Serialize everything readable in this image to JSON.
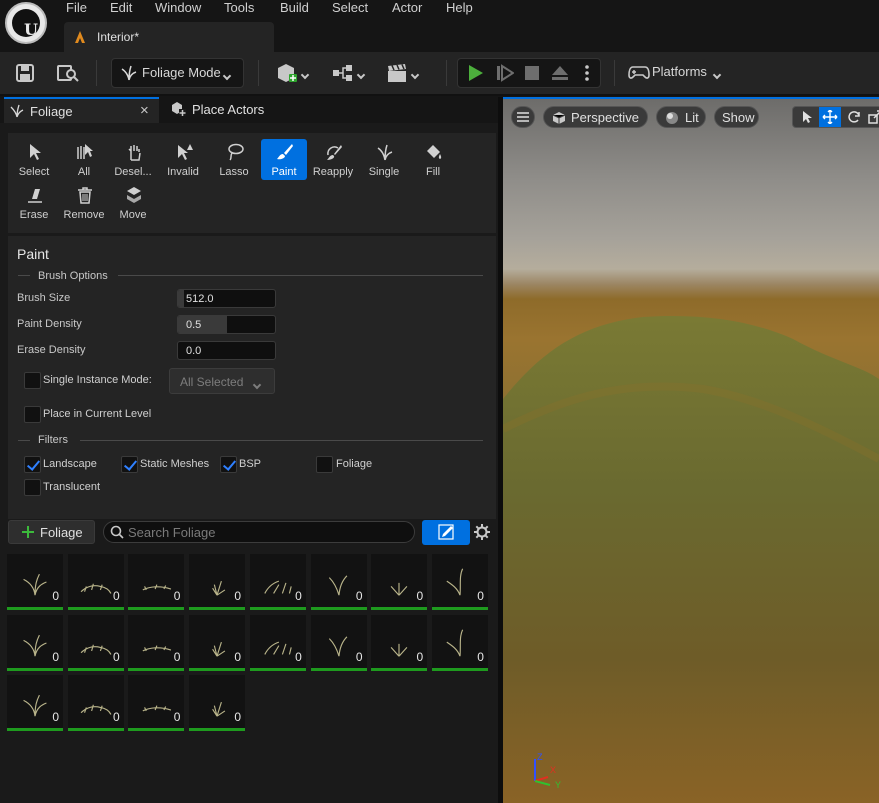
{
  "menubar": {
    "items": [
      "File",
      "Edit",
      "Window",
      "Tools",
      "Build",
      "Select",
      "Actor",
      "Help"
    ],
    "doc_tab": "Interior*"
  },
  "toolbar": {
    "mode_label": "Foliage Mode",
    "platforms_label": "Platforms",
    "play_color": "#4caf3c"
  },
  "panel_tabs": {
    "foliage": "Foliage",
    "place_actors": "Place Actors"
  },
  "tools": [
    {
      "label": "Select",
      "icon": "cursor-icon"
    },
    {
      "label": "All",
      "icon": "select-all-icon"
    },
    {
      "label": "Desel...",
      "icon": "deselect-icon"
    },
    {
      "label": "Invalid",
      "icon": "invalid-icon"
    },
    {
      "label": "Lasso",
      "icon": "lasso-icon"
    },
    {
      "label": "Paint",
      "icon": "brush-icon",
      "active": true
    },
    {
      "label": "Reapply",
      "icon": "reapply-icon"
    },
    {
      "label": "Single",
      "icon": "single-icon"
    },
    {
      "label": "Fill",
      "icon": "fill-icon"
    },
    {
      "label": "Erase",
      "icon": "eraser-icon"
    },
    {
      "label": "Remove",
      "icon": "trash-icon"
    },
    {
      "label": "Move",
      "icon": "move-icon"
    }
  ],
  "paint": {
    "title": "Paint",
    "brush_options_label": "Brush Options",
    "brush_size_label": "Brush Size",
    "brush_size": "512.0",
    "brush_size_fill": 0.06,
    "paint_density_label": "Paint Density",
    "paint_density": "0.5",
    "paint_density_fill": 0.5,
    "erase_density_label": "Erase Density",
    "erase_density": "0.0",
    "erase_density_fill": 0.0,
    "single_instance_label": "Single Instance Mode:",
    "single_instance_checked": false,
    "all_selected": "All Selected",
    "place_current_level_label": "Place in Current Level",
    "place_current_level_checked": false,
    "filters_label": "Filters",
    "filters": [
      {
        "label": "Landscape",
        "checked": true
      },
      {
        "label": "Static Meshes",
        "checked": true
      },
      {
        "label": "BSP",
        "checked": true
      },
      {
        "label": "Foliage",
        "checked": false
      },
      {
        "label": "Translucent",
        "checked": false
      }
    ]
  },
  "foliage_bar": {
    "add_label": "Foliage",
    "search_placeholder": "Search Foliage"
  },
  "foliage_counts": [
    "0",
    "0",
    "0",
    "0",
    "0",
    "0",
    "0",
    "0",
    "0",
    "0",
    "0",
    "0",
    "0",
    "0",
    "0",
    "0",
    "0",
    "0",
    "0",
    "0"
  ],
  "viewport": {
    "perspective_label": "Perspective",
    "lit_label": "Lit",
    "show_label": "Show",
    "accent": "#0070e0"
  }
}
